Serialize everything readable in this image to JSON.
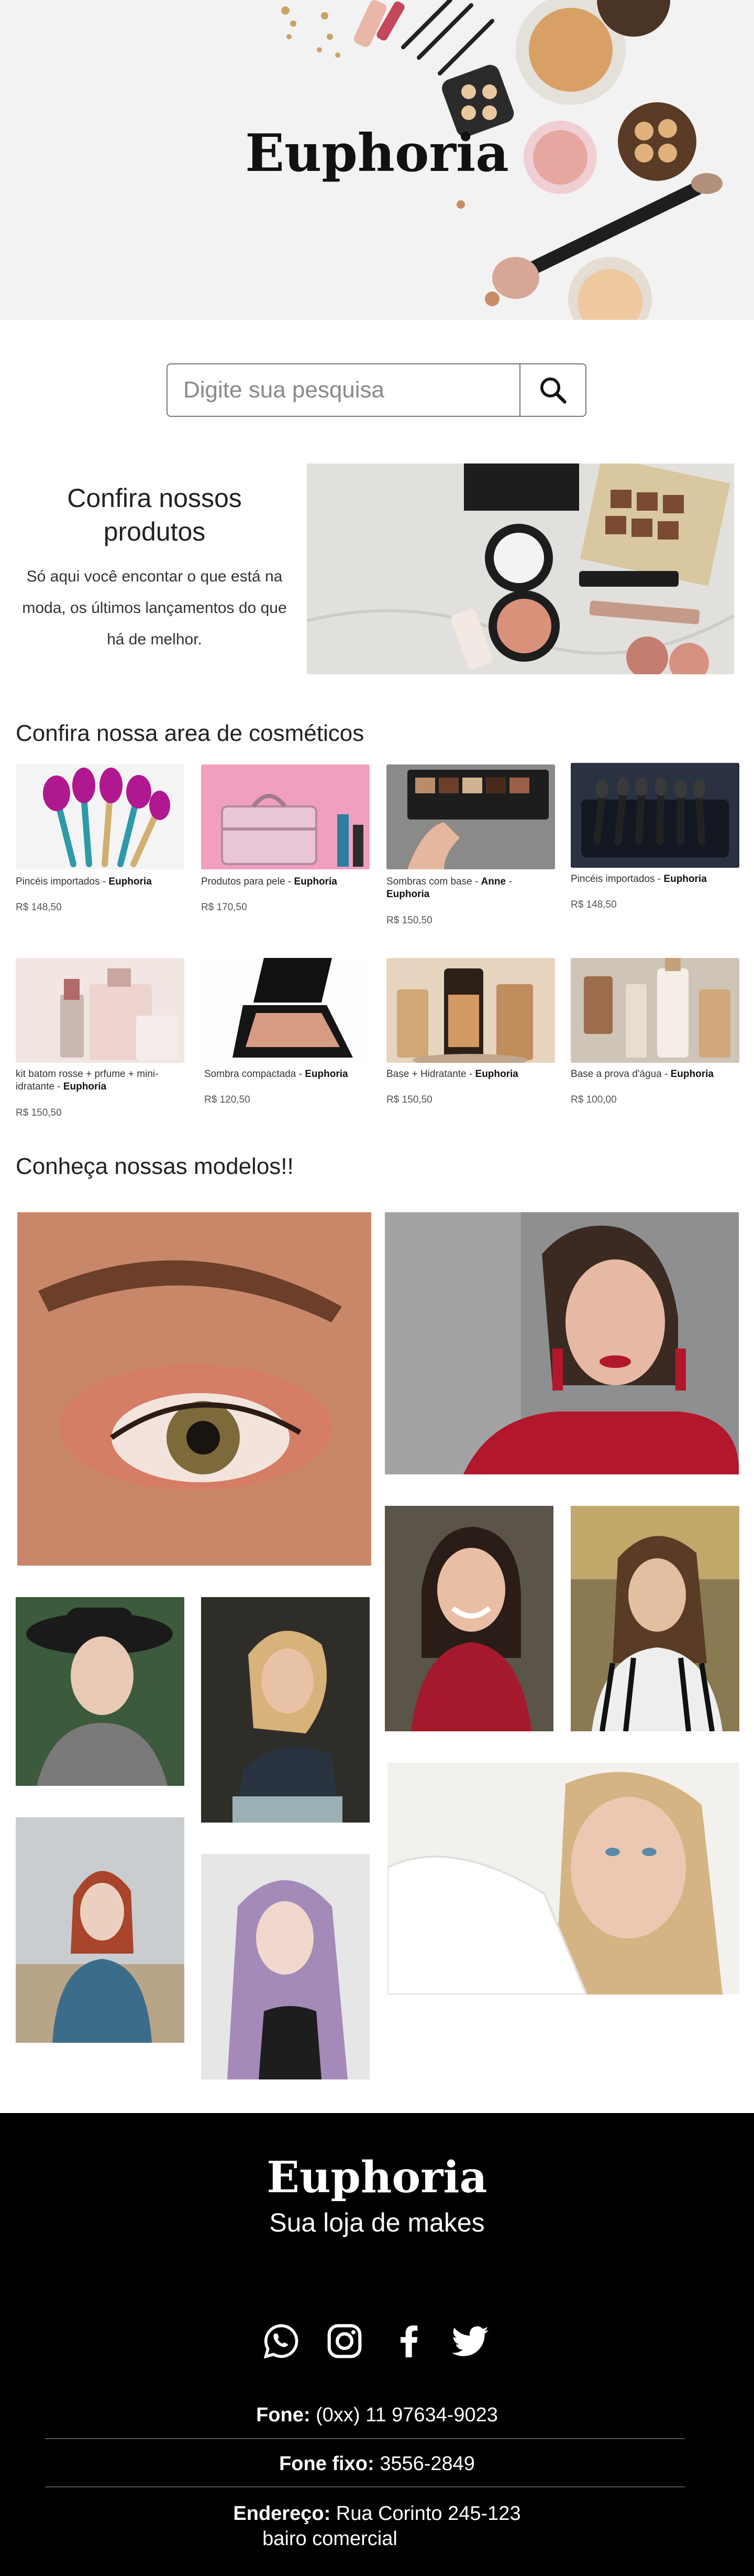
{
  "brand": "Euphoria",
  "search": {
    "placeholder": "Digite sua pesquisa"
  },
  "promo": {
    "title": "Confira nossos produtos",
    "text": "Só aqui você encontar o que está na moda, os últimos lançamentos do que há de melhor."
  },
  "products_section": {
    "title": "Confira nossa area de cosméticos",
    "items": [
      {
        "name": "Pincéis importados",
        "brand": "Euphoria",
        "price": "R$ 148,50"
      },
      {
        "name": "Produtos para pele",
        "brand": "Euphoria",
        "price": "R$ 170,50"
      },
      {
        "name": "Sombras com base",
        "by": "Anne",
        "brand": "Euphoria",
        "price": "R$ 150,50"
      },
      {
        "name": "Pincéis importados",
        "brand": "Euphoria",
        "price": "R$ 148,50"
      },
      {
        "name": "kit batom rosse + prfume + mini-idratante",
        "brand": "Euphoria",
        "price": "R$ 150,50"
      },
      {
        "name": "Sombra compactada",
        "brand": "Euphoria",
        "price": "R$ 120,50"
      },
      {
        "name": "Base + Hidratante",
        "brand": "Euphoria",
        "price": "R$ 150,50"
      },
      {
        "name": "Base a prova d'água",
        "brand": "Euphoria",
        "price": "R$ 100,00"
      }
    ]
  },
  "models_section": {
    "title": "Conheça nossas modelos!!"
  },
  "footer": {
    "brand": "Euphoria",
    "subtitle": "Sua loja de makes",
    "social": [
      "whatsapp-icon",
      "instagram-icon",
      "facebook-icon",
      "twitter-icon"
    ],
    "phone_label": "Fone:",
    "phone": "(0xx) 11 97634-9023",
    "landline_label": "Fone fixo:",
    "landline": "3556-2849",
    "address_label": "Endereço:",
    "address": "Rua Corinto 245-123",
    "address_line2": "bairo comercial"
  }
}
